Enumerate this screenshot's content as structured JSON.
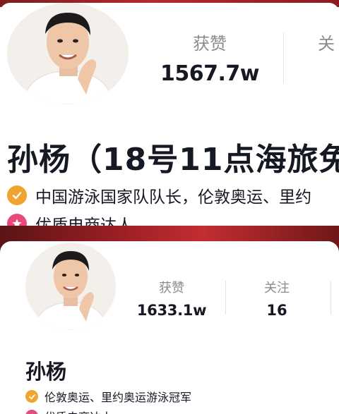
{
  "top_capture": {
    "stats": {
      "likes_label": "获赞",
      "likes_value": "1567.7w",
      "follow_label_partial": "关"
    },
    "profile_name": "孙杨（18号11点海旅免",
    "badges": [
      {
        "icon": "verified-check-icon",
        "text": "中国游泳国家队队长，伦敦奥运、里约"
      },
      {
        "icon": "quality-star-icon",
        "text": "优质电商达人"
      }
    ]
  },
  "bottom_capture": {
    "stats": {
      "likes_label": "获赞",
      "likes_value": "1633.1w",
      "follow_label": "关注",
      "follow_value": "16"
    },
    "profile_name": "孙杨",
    "badges": [
      {
        "icon": "verified-check-icon",
        "text": "伦敦奥运、里约奥运游泳冠军"
      },
      {
        "icon": "quality-star-icon",
        "text": "优质电商达人"
      }
    ]
  },
  "colors": {
    "banner_red": "#b7282e",
    "verified_badge": "#f0a530",
    "quality_badge": "#e84a7c",
    "text_primary": "#161823",
    "text_secondary": "#8a8a8f"
  }
}
